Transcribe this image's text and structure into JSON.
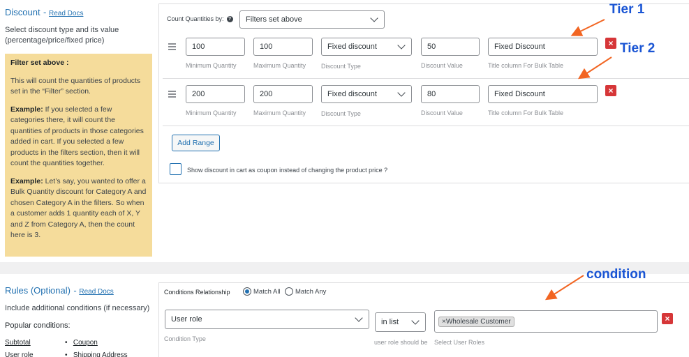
{
  "discount": {
    "title": "Discount",
    "read_docs": "Read Docs",
    "desc_line1": "Select discount type and its value",
    "desc_line2": "(percentage/price/fixed price)",
    "info": {
      "heading": "Filter set above :",
      "para1": "This will count the quantities of products set in the “Filter” section.",
      "example1_label": "Example:",
      "example1_text": " If you selected a few categories there, it will count the quantities of products in those categories added in cart. If you selected a few products in the filters section, then it will count the quantities together.",
      "example2_label": "Example:",
      "example2_text": " Let’s say, you wanted to offer a Bulk Quantity discount for Category A and chosen Category A in the filters. So when a customer adds 1 quantity each of X, Y and Z from Category A, then the count here is 3."
    }
  },
  "count_quantities": {
    "label": "Count Quantities by:",
    "help_icon": "?",
    "value": "Filters set above"
  },
  "ranges": [
    {
      "min": "100",
      "max": "100",
      "type": "Fixed discount",
      "value": "50",
      "title": "Fixed Discount"
    },
    {
      "min": "200",
      "max": "200",
      "type": "Fixed discount",
      "value": "80",
      "title": "Fixed Discount"
    }
  ],
  "range_labels": {
    "min": "Minimum Quantity",
    "max": "Maximum Quantity",
    "type": "Discount Type",
    "value": "Discount Value",
    "title": "Title column For Bulk Table"
  },
  "add_range_label": "Add Range",
  "coupon_checkbox_label": "Show discount in cart as coupon instead of changing the product price ?",
  "annotations": {
    "tier1": "Tier 1",
    "tier2": "Tier 2",
    "condition": "condition",
    "color": "#1a55d4",
    "arrow_color": "#f26522"
  },
  "rules": {
    "title": "Rules (Optional)",
    "read_docs": "Read Docs",
    "desc": "Include additional conditions (if necessary)",
    "popular_label": "Popular conditions:",
    "popular_left": [
      "Subtotal",
      "User role"
    ],
    "popular_right": [
      "Coupon",
      "Shipping Address"
    ]
  },
  "conditions": {
    "relationship_label": "Conditions Relationship",
    "match_all": "Match All",
    "match_any": "Match Any",
    "condition_type_value": "User role",
    "condition_type_label": "Condition Type",
    "operator_value": "in list",
    "operator_label": "user role should be",
    "roles_label": "Select User Roles",
    "selected_roles": [
      "Wholesale Customer"
    ]
  },
  "colors": {
    "accent": "#2271b1",
    "delete": "#d63638",
    "info_bg": "#f5dc9b"
  }
}
